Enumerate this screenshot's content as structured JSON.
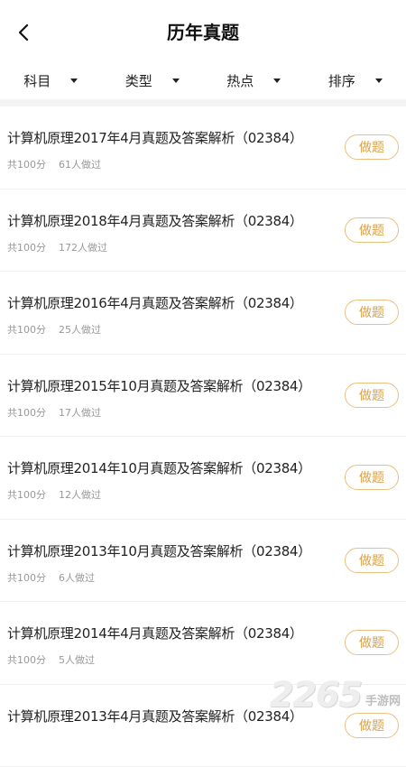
{
  "header": {
    "title": "历年真题",
    "back_icon": "chevron-left-icon"
  },
  "filters": [
    {
      "label": "科目"
    },
    {
      "label": "类型"
    },
    {
      "label": "热点"
    },
    {
      "label": "排序"
    }
  ],
  "items": [
    {
      "title": "计算机原理2017年4月真题及答案解析（02384）",
      "score": "共100分",
      "done": "61人做过",
      "button": "做题"
    },
    {
      "title": "计算机原理2018年4月真题及答案解析（02384）",
      "score": "共100分",
      "done": "172人做过",
      "button": "做题"
    },
    {
      "title": "计算机原理2016年4月真题及答案解析（02384）",
      "score": "共100分",
      "done": "25人做过",
      "button": "做题"
    },
    {
      "title": "计算机原理2015年10月真题及答案解析（02384）",
      "score": "共100分",
      "done": "17人做过",
      "button": "做题"
    },
    {
      "title": "计算机原理2014年10月真题及答案解析（02384）",
      "score": "共100分",
      "done": "12人做过",
      "button": "做题"
    },
    {
      "title": "计算机原理2013年10月真题及答案解析（02384）",
      "score": "共100分",
      "done": "6人做过",
      "button": "做题"
    },
    {
      "title": "计算机原理2014年4月真题及答案解析（02384）",
      "score": "共100分",
      "done": "5人做过",
      "button": "做题"
    },
    {
      "title": "计算机原理2013年4月真题及答案解析（02384）",
      "score": "",
      "done": "",
      "button": "做题"
    }
  ],
  "watermark": {
    "number": "2265",
    "text": "手游网"
  },
  "colors": {
    "accent": "#d9a24a",
    "accent_border": "#e8c07f",
    "meta_gray": "#999999"
  }
}
